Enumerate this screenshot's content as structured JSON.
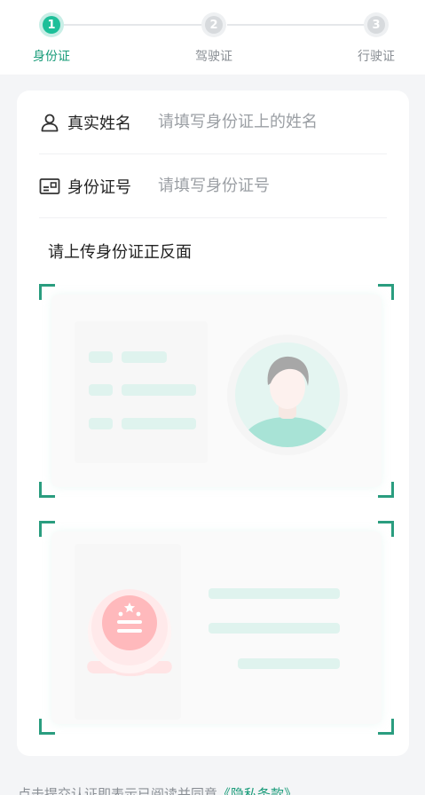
{
  "steps": [
    {
      "num": "1",
      "label": "身份证",
      "state": "active"
    },
    {
      "num": "2",
      "label": "驾驶证",
      "state": "inactive"
    },
    {
      "num": "3",
      "label": "行驶证",
      "state": "inactive"
    }
  ],
  "form": {
    "name": {
      "label": "真实姓名",
      "placeholder": "请填写身份证上的姓名",
      "icon": "person-icon"
    },
    "id_number": {
      "label": "身份证号",
      "placeholder": "请填写身份证号",
      "icon": "id-card-icon"
    }
  },
  "upload": {
    "title": "请上传身份证正反面",
    "front": "id-card-front-photo-slot",
    "back": "id-card-back-emblem-slot"
  },
  "footer": {
    "text": "点击提交认证即表示已阅读并同意",
    "link": "《隐私条款》"
  },
  "colors": {
    "accent": "#1dbf99",
    "accent_dark": "#2a9d7f",
    "emblem": "#ffb9bc",
    "mint": "#dff3ee"
  }
}
